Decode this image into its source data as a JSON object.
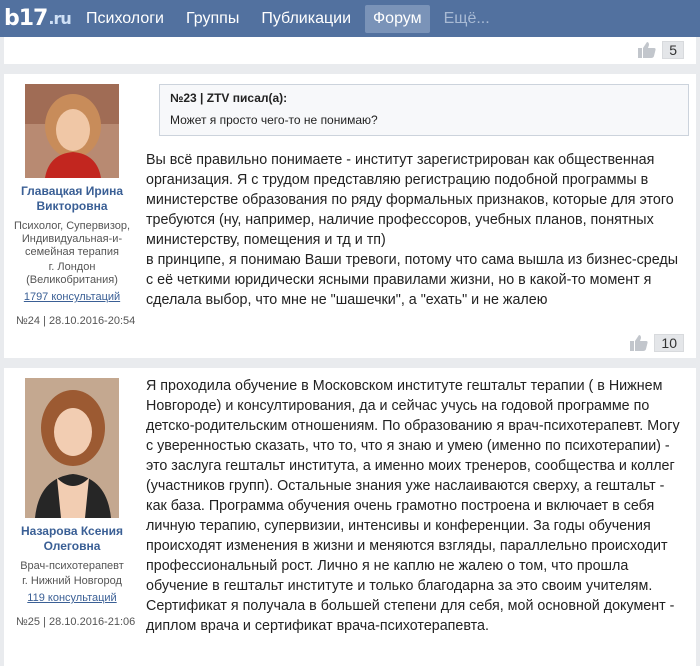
{
  "nav": {
    "logo": "b17",
    "logo_tld": ".ru",
    "items": [
      {
        "label": "Психологи"
      },
      {
        "label": "Группы"
      },
      {
        "label": "Публикации"
      },
      {
        "label": "Форум",
        "active": true
      },
      {
        "label": "Ещё..."
      }
    ]
  },
  "prev_post": {
    "likes": "5"
  },
  "posts": [
    {
      "author_name": "Главацкая Ирина Викторовна",
      "author_meta": "Психолог, Супервизор, Индивидуальная-и-семейная терапия",
      "location": "г. Лондон (Великобритания)",
      "consultations": "1797 консультаций",
      "post_meta": "№24 | 28.10.2016-20:54",
      "quote_title": "№23 | ZTV писал(а):",
      "quote_text": "Может я просто чего-то не понимаю?",
      "text": "Вы всё правильно понимаете - институт зарегистрирован как общественная организация. Я с трудом представляю регистрацию подобной программы в министерстве образования по ряду формальных признаков, которые для этого требуются (ну, например, наличие профессоров, учебных планов, понятных министерству, помещения и тд и тп)\nв принципе, я понимаю Ваши тревоги, потому что сама вышла из бизнес-среды с её четкими юридически ясными правилами жизни, но в какой-то момент я сделала выбор, что мне не \"шашечки\", а \"ехать\" и не жалею",
      "likes": "10"
    },
    {
      "author_name": "Назарова Ксения Олеговна",
      "author_meta": "Врач-психотерапевт",
      "location": "г. Нижний Новгород",
      "consultations": "119 консультаций",
      "post_meta": "№25 | 28.10.2016-21:06",
      "text": "Я проходила обучение в Московском институте гештальт терапии ( в Нижнем Новгороде) и консултирования, да и сейчас учусь на годовой программе по детско-родительским отношениям. По образованию я врач-психотерапевт. Могу с уверенностью сказать, что то, что я знаю и умею (именно по психотерапии) - это заслуга гештальт института, а именно моих тренеров, сообщества и коллег (участников групп). Остальные знания уже наслаиваются сверху, а гештальт - как база. Программа обучения очень грамотно построена и включает в себя личную терапию, супервизии, интенсивы и конференции. За годы обучения происходят изменения в жизни и меняются взгляды, параллельно происходит профессиональный рост. Лично я не каплю не жалею о том, что прошла обучение в гештальт институте и только благодарна за это своим учителям.\nСертификат я получала в большей степени для себя, мой основной документ - диплом врача и сертификат врача-психотерапевта."
    }
  ],
  "colors": {
    "nav_bg": "#52719f",
    "link": "#3a5f95",
    "page_bg": "#e9ebee"
  }
}
